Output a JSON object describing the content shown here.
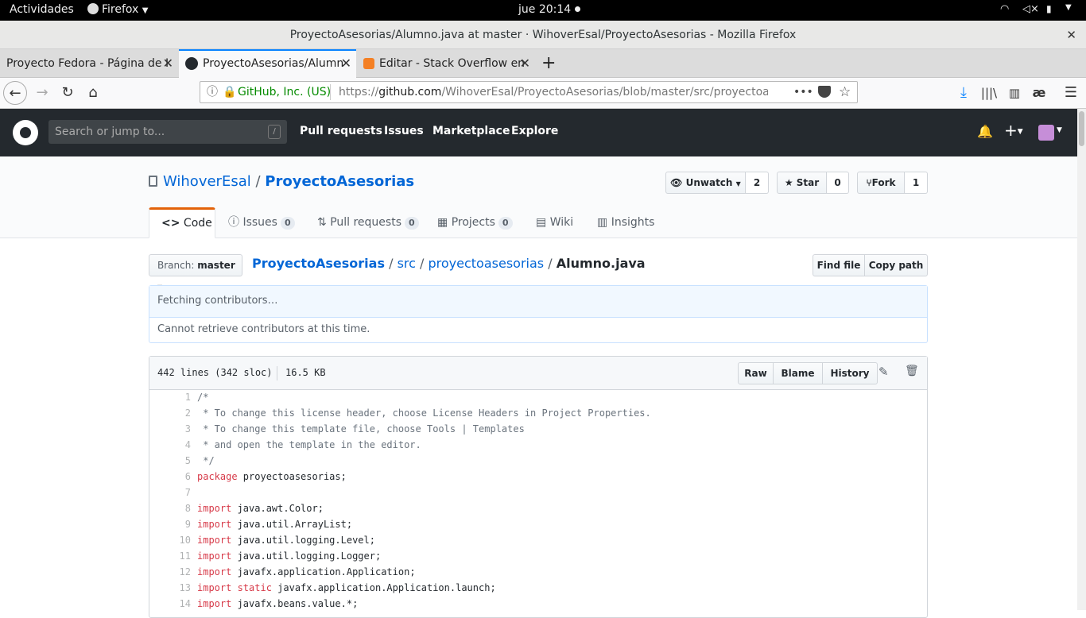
{
  "gnome": {
    "activities": "Actividades",
    "app": "Firefox",
    "clock": "jue 20:14"
  },
  "window_title": "ProyectoAsesorias/Alumno.java at master · WihoverEsal/ProyectoAsesorias - Mozilla Firefox",
  "tabs": [
    {
      "label": "Proyecto Fedora - Página de I"
    },
    {
      "label": "ProyectoAsesorias/Alumn"
    },
    {
      "label": "Editar - Stack Overflow en"
    }
  ],
  "url": {
    "identity": "GitHub, Inc. (US)",
    "prefix": "https://",
    "host": "github.com",
    "path": "/WihoverEsal/ProyectoAsesorias/blob/master/src/proyectoasesor"
  },
  "gh": {
    "search_placeholder": "Search or jump to...",
    "slash": "/",
    "nav": [
      "Pull requests",
      "Issues",
      "Marketplace",
      "Explore"
    ]
  },
  "repo": {
    "owner": "WihoverEsal",
    "sep": "/",
    "name": "ProyectoAsesorias",
    "unwatch": "Unwatch",
    "watch_count": "2",
    "star": "Star",
    "star_count": "0",
    "fork": "Fork",
    "fork_count": "1",
    "tabs": [
      {
        "label": "Code"
      },
      {
        "label": "Issues",
        "count": "0"
      },
      {
        "label": "Pull requests",
        "count": "0"
      },
      {
        "label": "Projects",
        "count": "0"
      },
      {
        "label": "Wiki"
      },
      {
        "label": "Insights"
      }
    ]
  },
  "file": {
    "branch_label": "Branch:",
    "branch": "master",
    "crumbs": [
      "ProyectoAsesorias",
      "/",
      "src",
      "/",
      "proyectoasesorias",
      "/",
      "Alumno.java"
    ],
    "find_file": "Find file",
    "copy_path": "Copy path",
    "fetching": "Fetching contributors…",
    "cannot": "Cannot retrieve contributors at this time.",
    "lines_info": "442 lines (342 sloc)",
    "size": "16.5 KB",
    "raw": "Raw",
    "blame": "Blame",
    "history": "History"
  },
  "code": [
    {
      "n": "1",
      "t": "/*",
      "c": "cm"
    },
    {
      "n": "2",
      "t": " * To change this license header, choose License Headers in Project Properties.",
      "c": "cm"
    },
    {
      "n": "3",
      "t": " * To change this template file, choose Tools | Templates",
      "c": "cm"
    },
    {
      "n": "4",
      "t": " * and open the template in the editor.",
      "c": "cm"
    },
    {
      "n": "5",
      "t": " */",
      "c": "cm"
    },
    {
      "n": "6",
      "k": "package",
      "t": " proyectoasesorias;"
    },
    {
      "n": "7",
      "t": ""
    },
    {
      "n": "8",
      "k": "import",
      "t": " java.awt.Color;"
    },
    {
      "n": "9",
      "k": "import",
      "t": " java.util.ArrayList;"
    },
    {
      "n": "10",
      "k": "import",
      "t": " java.util.logging.Level;"
    },
    {
      "n": "11",
      "k": "import",
      "t": " java.util.logging.Logger;"
    },
    {
      "n": "12",
      "k": "import",
      "t": " javafx.application.Application;"
    },
    {
      "n": "13",
      "k": "import static",
      "t": " javafx.application.Application.launch;"
    },
    {
      "n": "14",
      "k": "import",
      "t": " javafx.beans.value.*;"
    }
  ]
}
